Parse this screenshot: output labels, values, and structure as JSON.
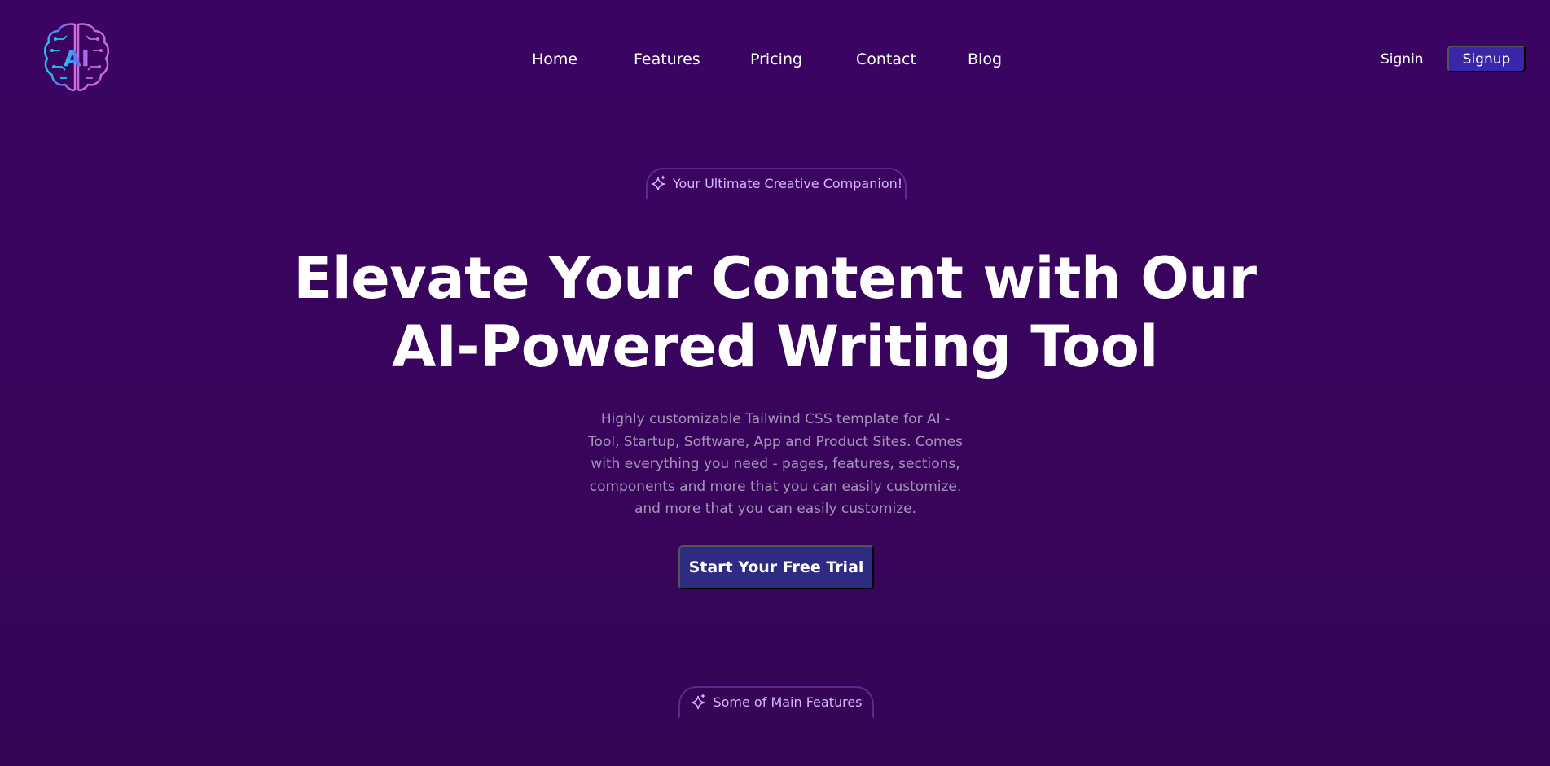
{
  "header": {
    "logo_icon": "ai-brain-logo-icon",
    "logo_text": "AI",
    "nav": [
      {
        "label": "Home"
      },
      {
        "label": "Features"
      },
      {
        "label": "Pricing"
      },
      {
        "label": "Contact"
      },
      {
        "label": "Blog"
      }
    ],
    "signin_label": "Signin",
    "signup_label": "Signup"
  },
  "hero": {
    "badge_icon": "sparkle-icon",
    "badge_text": "Your Ultimate Creative Companion!",
    "title_line1": "Elevate Your Content with Our",
    "title_line2": "AI-Powered Writing Tool",
    "subtitle": "Highly customizable Tailwind CSS template for AI - Tool, Startup, Software, App and Product Sites. Comes with everything you need - pages, features, sections, components and more that you can easily customize. and more that you can easily customize.",
    "cta_label": "Start Your Free Trial"
  },
  "features": {
    "badge_icon": "sparkle-icon",
    "badge_text": "Some of Main Features"
  },
  "colors": {
    "background": "#3b0463",
    "accent_button": "#3a26a8",
    "cta_button": "#2d2b82",
    "badge_text": "#d6b7ff",
    "subtitle_text": "#a594b8"
  }
}
